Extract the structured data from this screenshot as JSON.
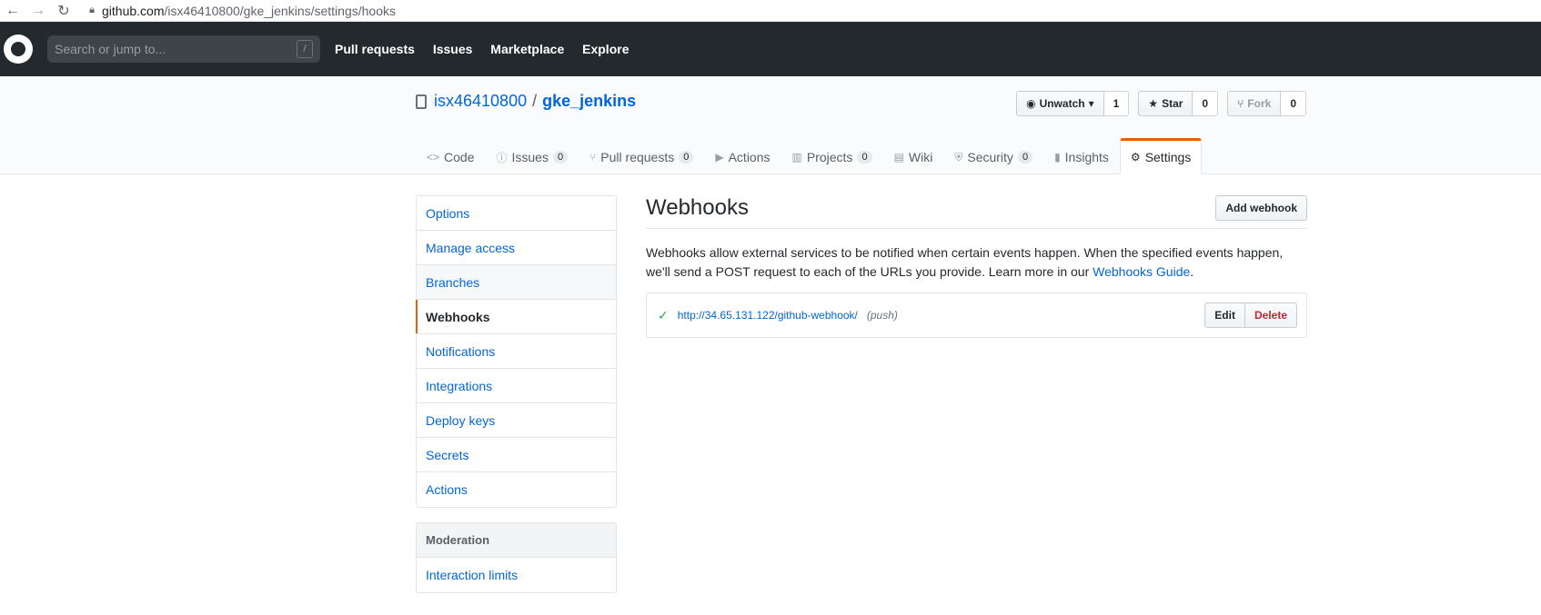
{
  "browser": {
    "url_host": "github.com",
    "url_path": "/isx46410800/gke_jenkins/settings/hooks"
  },
  "header": {
    "search_placeholder": "Search or jump to...",
    "search_key": "/",
    "nav": [
      "Pull requests",
      "Issues",
      "Marketplace",
      "Explore"
    ]
  },
  "repo": {
    "owner": "isx46410800",
    "separator": "/",
    "name": "gke_jenkins",
    "watch_label": "Unwatch",
    "watch_count": "1",
    "star_label": "Star",
    "star_count": "0",
    "fork_label": "Fork",
    "fork_count": "0"
  },
  "tabs": [
    {
      "label": "Code",
      "icon": "code-icon",
      "glyph": "<>"
    },
    {
      "label": "Issues",
      "icon": "issue-icon",
      "glyph": "ⓘ",
      "count": "0"
    },
    {
      "label": "Pull requests",
      "icon": "pull-request-icon",
      "glyph": "⑂",
      "count": "0"
    },
    {
      "label": "Actions",
      "icon": "play-icon",
      "glyph": "▶"
    },
    {
      "label": "Projects",
      "icon": "project-icon",
      "glyph": "▥",
      "count": "0"
    },
    {
      "label": "Wiki",
      "icon": "book-icon",
      "glyph": "▤"
    },
    {
      "label": "Security",
      "icon": "shield-icon",
      "glyph": "⛨",
      "count": "0"
    },
    {
      "label": "Insights",
      "icon": "graph-icon",
      "glyph": "▮"
    },
    {
      "label": "Settings",
      "icon": "gear-icon",
      "glyph": "⚙"
    }
  ],
  "settings_menu": [
    "Options",
    "Manage access",
    "Branches",
    "Webhooks",
    "Notifications",
    "Integrations",
    "Deploy keys",
    "Secrets",
    "Actions"
  ],
  "moderation": {
    "heading": "Moderation",
    "items": [
      "Interaction limits"
    ]
  },
  "webhooks": {
    "title": "Webhooks",
    "add_label": "Add webhook",
    "description_prefix": "Webhooks allow external services to be notified when certain events happen. When the specified events happen, we'll send a POST request to each of the URLs you provide. Learn more in our ",
    "guide_link": "Webhooks Guide",
    "description_suffix": ".",
    "hooks": [
      {
        "url": "http://34.65.131.122/github-webhook/",
        "events": "(push)",
        "status_icon": "check-icon"
      }
    ],
    "edit_label": "Edit",
    "delete_label": "Delete"
  },
  "colors": {
    "header_bg": "#24292e",
    "link": "#0366d6",
    "accent": "#e36209",
    "success": "#28a745",
    "danger": "#cb2431"
  }
}
